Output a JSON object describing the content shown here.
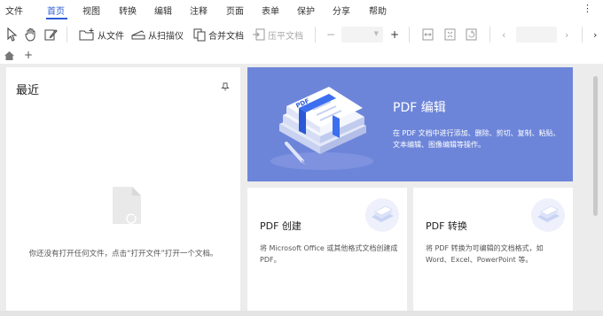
{
  "menu": {
    "file": "文件",
    "home": "首页",
    "view": "视图",
    "convert": "转换",
    "edit": "编辑",
    "annotate": "注释",
    "page": "页面",
    "form": "表单",
    "protect": "保护",
    "share": "分享",
    "help": "帮助"
  },
  "toolbar": {
    "from_file": "从文件",
    "from_scanner": "从扫描仪",
    "merge_docs": "合并文档",
    "flatten_doc": "压平文档"
  },
  "recent": {
    "title": "最近",
    "empty_text": "你还没有打开任何文件，点击“打开文件”打开一个文档。"
  },
  "hero": {
    "title": "PDF 编辑",
    "description": "在 PDF 文档中进行添加、删除、剪切、复制、粘贴、文本编辑、图像编辑等操作。",
    "art_label": "PDF"
  },
  "cards": [
    {
      "title": "PDF 创建",
      "description": "将 Microsoft Office 或其他格式文档创建成 PDF。"
    },
    {
      "title": "PDF 转换",
      "description": "将 PDF 转换为可编辑的文档格式，如 Word、Excel、PowerPoint 等。"
    }
  ],
  "colors": {
    "accent": "#2d5cd7",
    "hero_bg": "#6d85d9",
    "content_bg": "#ececec"
  }
}
